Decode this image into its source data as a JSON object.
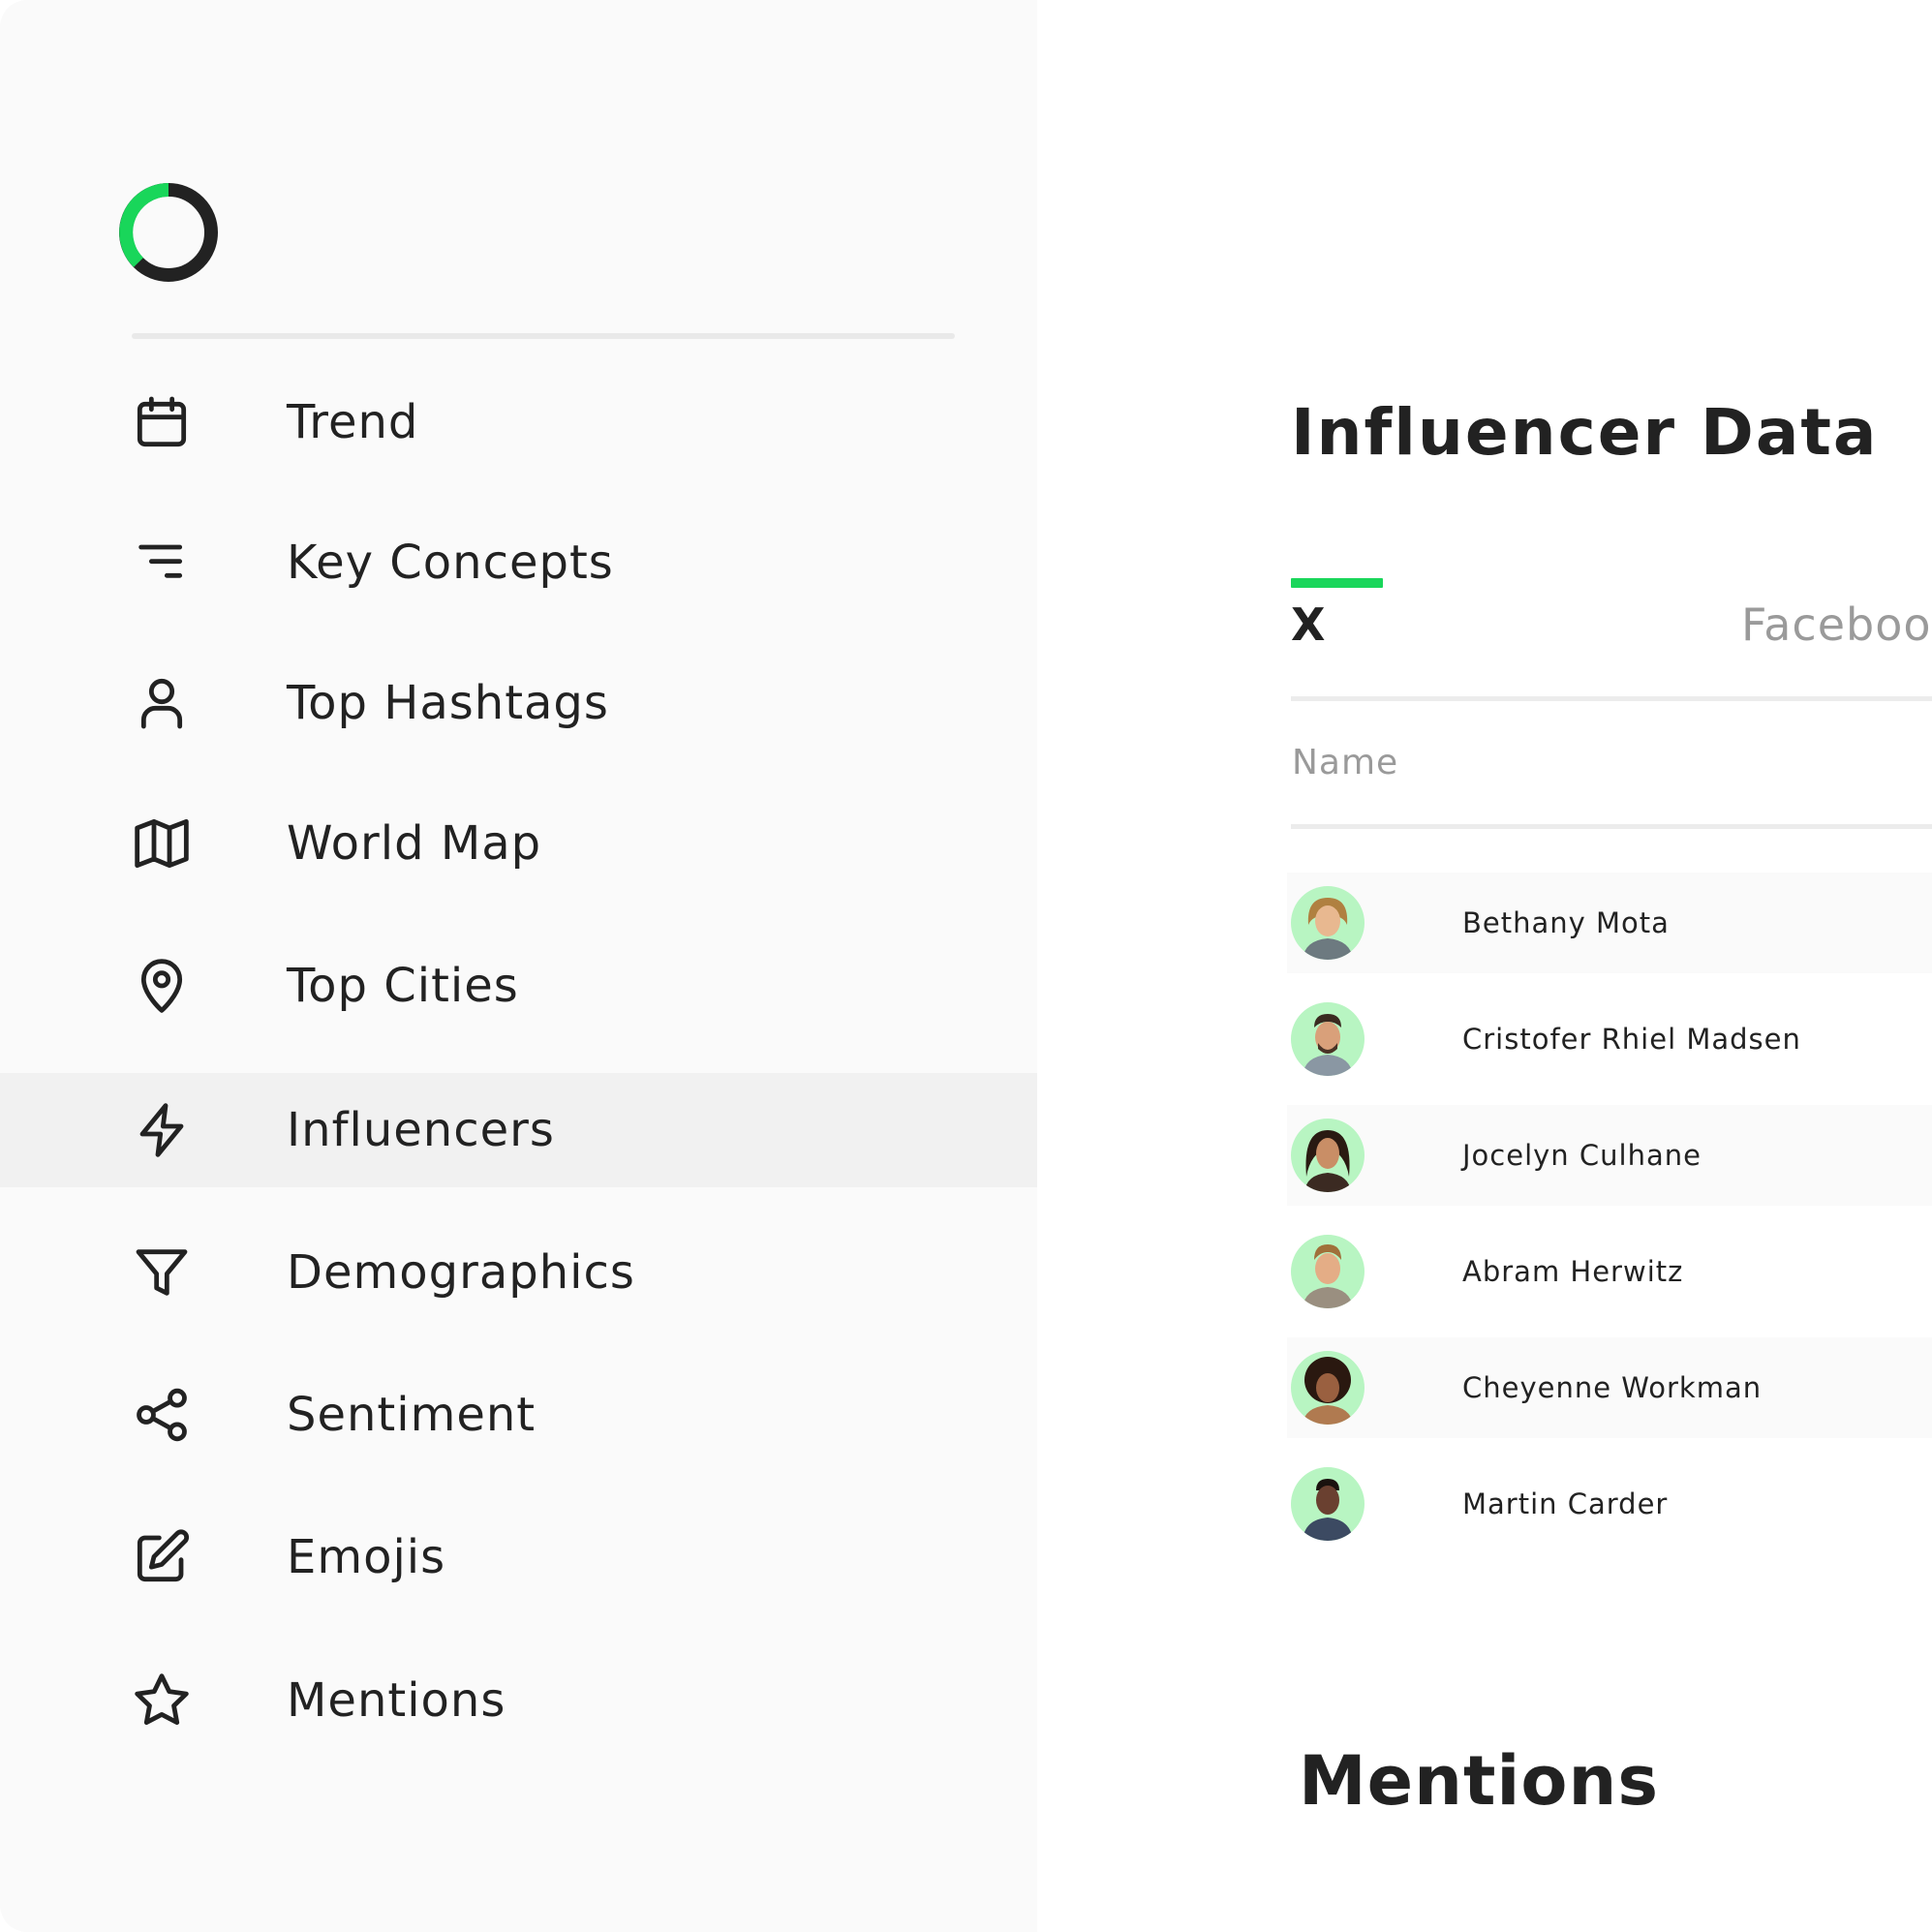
{
  "brand": {
    "accent_color": "#19d65a",
    "dark_color": "#222222",
    "logo_icon": "ring-logo-icon"
  },
  "sidebar": {
    "items": [
      {
        "label": "Trend",
        "icon": "calendar-icon",
        "active": false
      },
      {
        "label": "Key Concepts",
        "icon": "filter-lines-icon",
        "active": false
      },
      {
        "label": "Top Hashtags",
        "icon": "user-icon",
        "active": false
      },
      {
        "label": "World Map",
        "icon": "map-icon",
        "active": false
      },
      {
        "label": "Top Cities",
        "icon": "map-pin-icon",
        "active": false
      },
      {
        "label": "Influencers",
        "icon": "lightning-icon",
        "active": true
      },
      {
        "label": "Demographics",
        "icon": "funnel-icon",
        "active": false
      },
      {
        "label": "Sentiment",
        "icon": "share-icon",
        "active": false
      },
      {
        "label": "Emojis",
        "icon": "edit-icon",
        "active": false
      },
      {
        "label": "Mentions",
        "icon": "star-icon",
        "active": false
      }
    ]
  },
  "main": {
    "title": "Influencer Data",
    "tabs": [
      {
        "label": "X",
        "active": true
      },
      {
        "label": "Faceboo",
        "active": false
      }
    ],
    "table": {
      "column_header": "Name",
      "rows": [
        {
          "name": "Bethany Mota"
        },
        {
          "name": "Cristofer Rhiel Madsen"
        },
        {
          "name": "Jocelyn Culhane"
        },
        {
          "name": "Abram Herwitz"
        },
        {
          "name": "Cheyenne Workman"
        },
        {
          "name": "Martin Carder"
        }
      ]
    },
    "next_section_title": "Mentions"
  }
}
